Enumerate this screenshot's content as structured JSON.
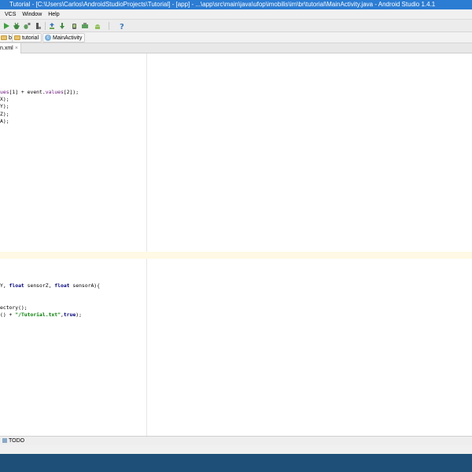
{
  "window": {
    "title": "Tutorial - [C:\\Users\\Carlos\\AndroidStudioProjects\\Tutorial] - [app] - ...\\app\\src\\main\\java\\ufop\\imobilis\\im\\br\\tutorial\\MainActivity.java - Android Studio 1.4.1"
  },
  "menu": {
    "items": [
      "VCS",
      "Window",
      "Help"
    ]
  },
  "toolbar": {
    "icons": [
      "run-icon",
      "debug-icon",
      "attach-debugger-icon",
      "profile-icon",
      "sdk-manager-icon",
      "avd-manager-icon",
      "android-monitor-icon",
      "help-icon"
    ]
  },
  "breadcrumb": {
    "items": [
      "br",
      "tutorial",
      "MainActivity"
    ]
  },
  "tabs": {
    "active": "n.xml",
    "close": "×"
  },
  "code": {
    "line1_prefix": "",
    "line1_field1": "ues",
    "line1_mid": "[1] + event.",
    "line1_field2": "values",
    "line1_end": "[2]);",
    "line2": "X);",
    "line3": "Y);",
    "line4": "Z);",
    "line5": "A);",
    "line6_pre": "Y, ",
    "line6_kw1": "float",
    "line6_mid1": " sensorZ, ",
    "line6_kw2": "float",
    "line6_end": " sensorA){",
    "line7": "ectory();",
    "line8_pre": "() + ",
    "line8_str": "\"/Tutorial.txt\"",
    "line8_mid": ",",
    "line8_kw": "true",
    "line8_end": ");"
  },
  "bottom": {
    "todo_label": "TODO"
  },
  "colors": {
    "title_bar": "#2b7cd3",
    "taskbar": "#1d4f78",
    "caret_row": "#fff9e5",
    "field": "#660e7a",
    "keyword": "#000080",
    "string": "#008000"
  }
}
